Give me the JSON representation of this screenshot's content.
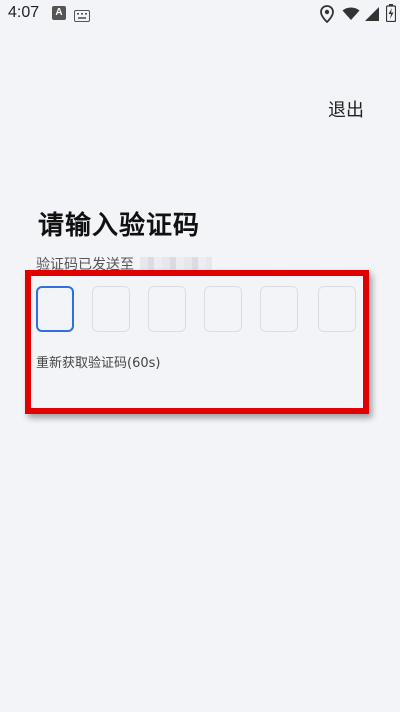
{
  "status_bar": {
    "time": "4:07",
    "a_icon": "A"
  },
  "header": {
    "exit_label": "退出"
  },
  "main": {
    "title": "请输入验证码",
    "sent_prefix": "验证码已发送至",
    "code_boxes": [
      "",
      "",
      "",
      "",
      "",
      ""
    ],
    "resend_label": "重新获取验证码(60s)"
  },
  "colors": {
    "accent": "#2f6fe0",
    "highlight": "#e00000",
    "background": "#f3f4f8"
  }
}
